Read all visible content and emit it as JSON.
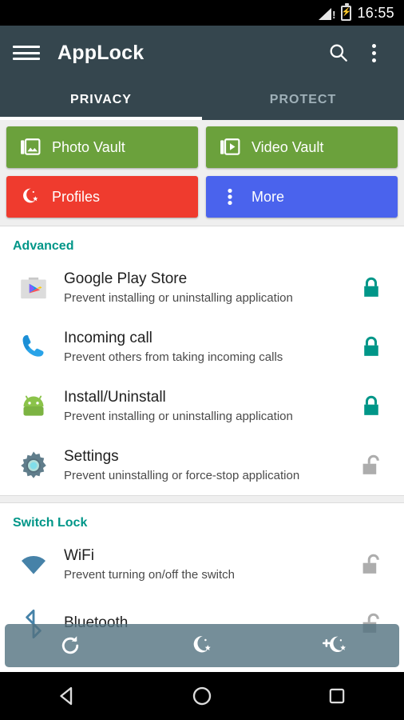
{
  "status_bar": {
    "clock": "16:55",
    "signal_icon": "signal-warning-icon",
    "signal_badge": "!",
    "battery_icon": "battery-charging-icon",
    "battery_glyph": "⚡"
  },
  "app_bar": {
    "menu_icon": "hamburger-menu-icon",
    "title": "AppLock",
    "search_icon": "search-icon",
    "overflow_icon": "overflow-menu-icon"
  },
  "tabs": [
    {
      "label": "PRIVACY",
      "active": true
    },
    {
      "label": "PROTECT",
      "active": false
    }
  ],
  "tiles": [
    {
      "label": "Photo Vault",
      "icon": "photo-library-icon",
      "color": "#6ba13c"
    },
    {
      "label": "Video Vault",
      "icon": "video-library-icon",
      "color": "#6ba13c"
    },
    {
      "label": "Profiles",
      "icon": "moon-star-icon",
      "color": "#ef3b2e"
    },
    {
      "label": "More",
      "icon": "overflow-menu-icon",
      "color": "#4a63ed"
    }
  ],
  "sections": [
    {
      "header": "Advanced",
      "header_color": "#009688",
      "rows": [
        {
          "title": "Google Play Store",
          "subtitle": "Prevent installing or uninstalling application",
          "icon": "google-play-store-icon",
          "lock_state": "locked",
          "lock_color": "#009688"
        },
        {
          "title": "Incoming call",
          "subtitle": "Prevent others from taking incoming calls",
          "icon": "phone-icon",
          "lock_state": "locked",
          "lock_color": "#009688"
        },
        {
          "title": "Install/Uninstall",
          "subtitle": "Prevent installing or uninstalling application",
          "icon": "android-robot-icon",
          "lock_state": "locked",
          "lock_color": "#009688"
        },
        {
          "title": "Settings",
          "subtitle": "Prevent uninstalling or force-stop application",
          "icon": "settings-gear-icon",
          "lock_state": "unlocked",
          "lock_color": "#adadad"
        }
      ]
    },
    {
      "header": "Switch Lock",
      "header_color": "#009688",
      "rows": [
        {
          "title": "WiFi",
          "subtitle": "Prevent turning on/off the switch",
          "icon": "wifi-icon",
          "lock_state": "unlocked",
          "lock_color": "#adadad"
        },
        {
          "title": "Bluetooth",
          "subtitle": "",
          "icon": "bluetooth-icon",
          "lock_state": "unlocked",
          "lock_color": "#adadad"
        }
      ]
    }
  ],
  "float_toolbar": [
    {
      "icon": "refresh-icon"
    },
    {
      "icon": "moon-star-icon"
    },
    {
      "icon": "add-moon-star-icon"
    }
  ],
  "nav_bar": [
    {
      "icon": "back-icon"
    },
    {
      "icon": "home-icon"
    },
    {
      "icon": "recents-icon"
    }
  ],
  "theme": {
    "appbar_color": "#35464e",
    "accent_teal": "#009688",
    "green": "#6ba13c",
    "red": "#ef3b2e",
    "blue": "#4a63ed"
  }
}
